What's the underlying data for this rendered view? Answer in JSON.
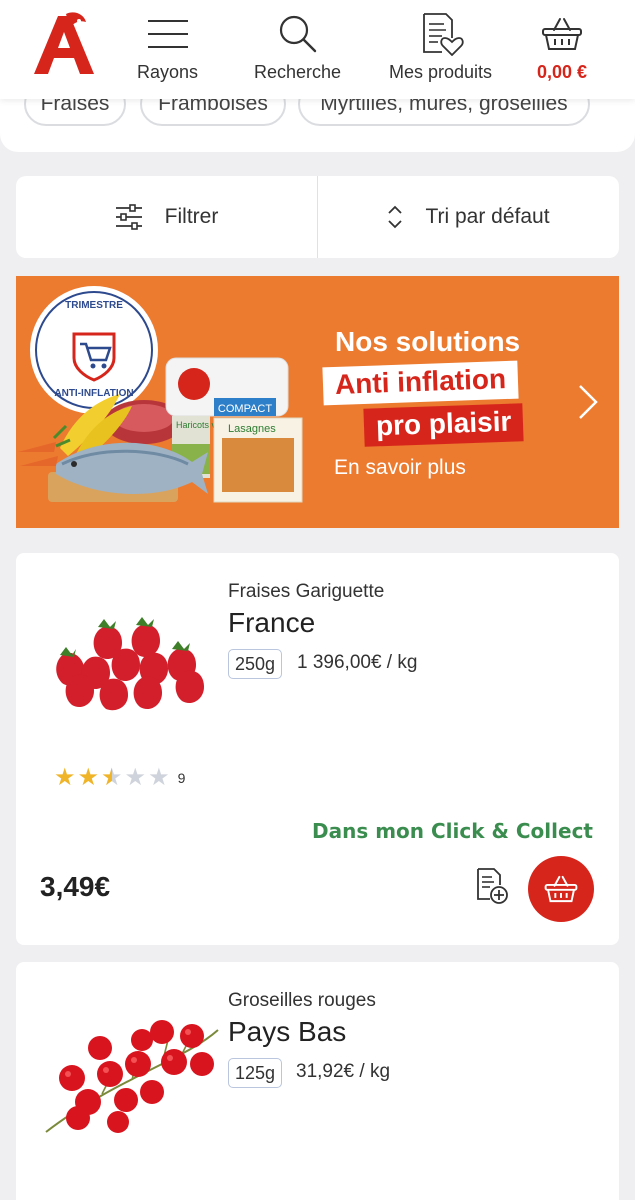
{
  "header": {
    "nav": [
      {
        "label": "Rayons",
        "icon": "menu-icon"
      },
      {
        "label": "Recherche",
        "icon": "search-icon"
      },
      {
        "label": "Mes produits",
        "icon": "list-heart-icon"
      },
      {
        "label": "0,00 €",
        "icon": "basket-icon"
      }
    ],
    "brand_color": "#d6261c"
  },
  "chips": [
    "Fraises",
    "Framboises",
    "Myrtilles, mûres, groseilles"
  ],
  "toolbar": {
    "filter_label": "Filtrer",
    "sort_label": "Tri par défaut"
  },
  "banner": {
    "badge_top": "TRIMESTRE",
    "badge_bottom": "ANTI-INFLATION",
    "title": "Nos solutions",
    "tag1": "Anti inflation",
    "tag2": "pro plaisir",
    "link": "En savoir plus",
    "pack_compact": "COMPACT",
    "pack_haricots": "Haricots verts",
    "pack_lasagnes": "Lasagnes",
    "background": "#ec7a2f"
  },
  "products": [
    {
      "name": "Fraises Gariguette",
      "origin": "France",
      "weight": "250g",
      "unit_price": "1 396,00€ / kg",
      "rating": 2.5,
      "rating_max": 5,
      "rating_count": "9",
      "availability": "Dans mon Click & Collect",
      "price": "3,49€"
    },
    {
      "name": "Groseilles rouges",
      "origin": "Pays Bas",
      "weight": "125g",
      "unit_price": "31,92€ / kg"
    }
  ]
}
